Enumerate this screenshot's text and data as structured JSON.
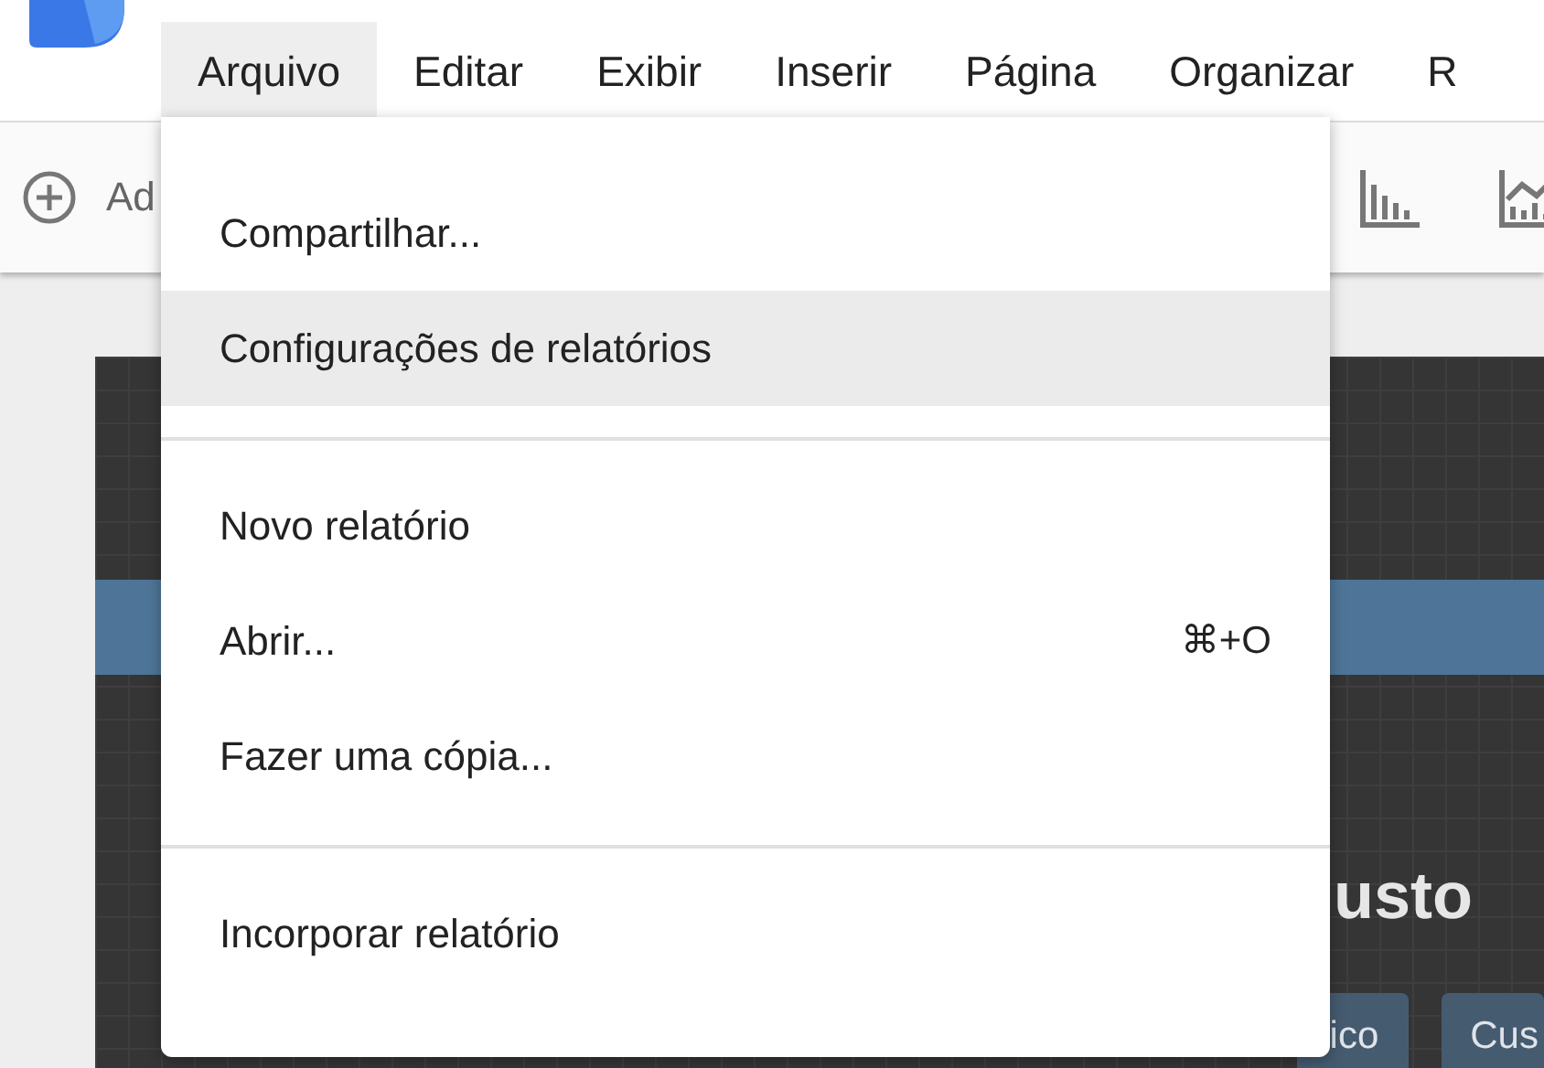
{
  "menu_bar": [
    {
      "label": "Arquivo",
      "selected": true
    },
    {
      "label": "Editar",
      "selected": false
    },
    {
      "label": "Exibir",
      "selected": false
    },
    {
      "label": "Inserir",
      "selected": false
    },
    {
      "label": "Página",
      "selected": false
    },
    {
      "label": "Organizar",
      "selected": false
    },
    {
      "label": "R",
      "selected": false
    }
  ],
  "toolbar": {
    "add_label": "Ad"
  },
  "report": {
    "heading": "usto",
    "chips": [
      "ico",
      "Cus"
    ]
  },
  "dropdown": {
    "groups": [
      [
        {
          "label": "Compartilhar...",
          "selected": false
        },
        {
          "label": "Configurações de relatórios",
          "selected": true
        }
      ],
      [
        {
          "label": "Novo relatório",
          "selected": false
        },
        {
          "label": "Abrir...",
          "shortcut": "⌘+O",
          "selected": false
        },
        {
          "label": "Fazer uma cópia...",
          "selected": false
        }
      ],
      [
        {
          "label": "Incorporar relatório",
          "selected": false
        }
      ]
    ]
  }
}
